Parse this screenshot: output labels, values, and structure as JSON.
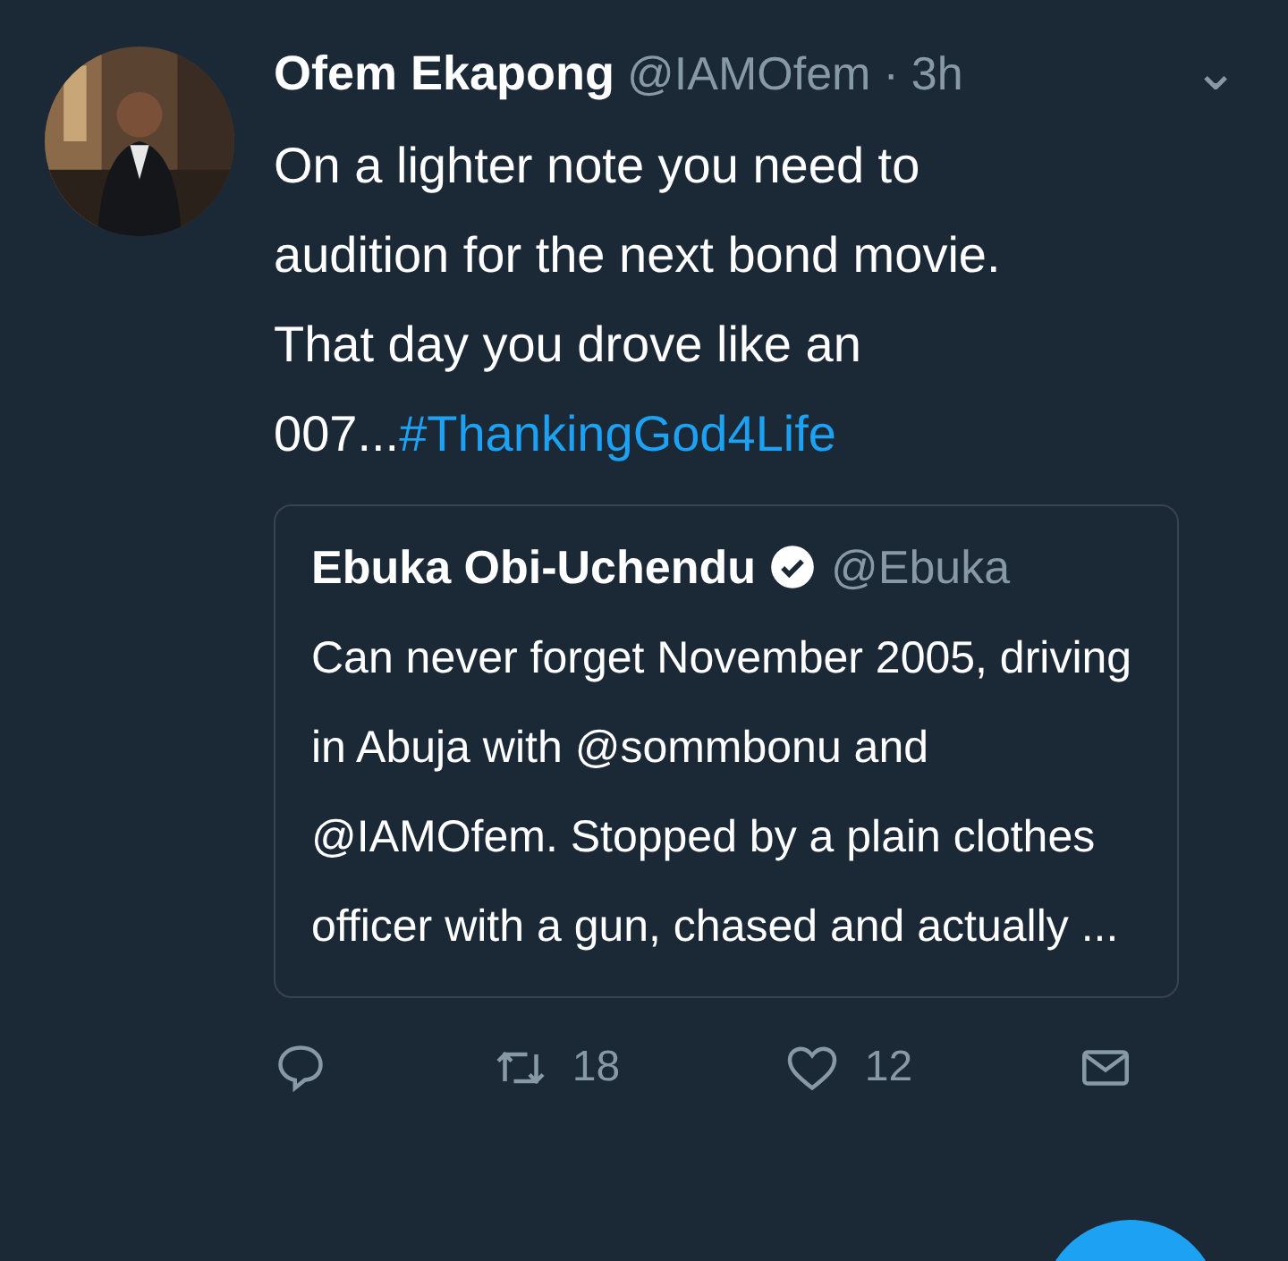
{
  "tweet": {
    "name": "Ofem Ekapong",
    "handle": "@IAMOfem",
    "separator": "·",
    "time": "3h",
    "menu": "⌄",
    "text": "On a lighter note you need to audition for the next bond movie. That day you drove like an 007...",
    "hashtag": "#ThankingGod4Life",
    "quote": {
      "name": "Ebuka Obi-Uchendu",
      "verified": true,
      "handle": "@Ebuka",
      "text": "Can never forget November 2005, driving in Abuja with @sommbonu and @IAMOfem. Stopped by a plain clothes officer with a gun, chased and actually ..."
    },
    "actions": [
      {
        "kind": "reply"
      },
      {
        "kind": "retweet",
        "count": "18"
      },
      {
        "kind": "like",
        "count": "12"
      },
      {
        "kind": "message"
      }
    ]
  }
}
